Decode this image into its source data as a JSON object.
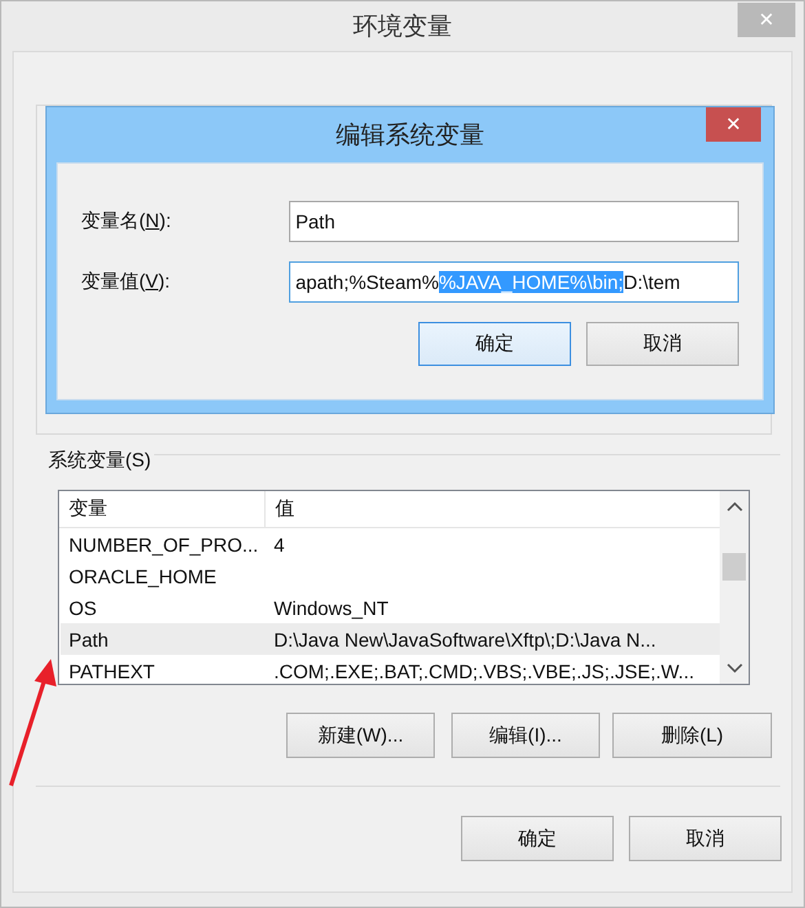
{
  "window": {
    "title": "环境变量",
    "close": "✕"
  },
  "dialog": {
    "title": "编辑系统变量",
    "close": "✕",
    "name_label": "变量名(**N**):",
    "name_value": "Path",
    "value_label": "变量值(**V**):",
    "value_before": "apath;%Steam%",
    "value_selected": "%JAVA_HOME%\\bin;",
    "value_after": "D:\\tem",
    "buttons": [
      {
        "label": "确定",
        "focused": true
      },
      {
        "label": "取消",
        "focused": false
      }
    ]
  },
  "system_vars": {
    "label": "系统变量(S)",
    "columns": [
      "变量",
      "值"
    ],
    "rows": [
      {
        "name": "NUMBER_OF_PRO...",
        "value": "4",
        "selected": false
      },
      {
        "name": "ORACLE_HOME",
        "value": "",
        "selected": false
      },
      {
        "name": "OS",
        "value": "Windows_NT",
        "selected": false
      },
      {
        "name": "Path",
        "value": "D:\\Java New\\JavaSoftware\\Xftp\\;D:\\Java N...",
        "selected": true
      },
      {
        "name": "PATHEXT",
        "value": ".COM;.EXE;.BAT;.CMD;.VBS;.VBE;.JS;.JSE;.W...",
        "selected": false
      }
    ],
    "buttons": [
      "新建(W)...",
      "编辑(I)...",
      "删除(L)"
    ]
  },
  "buttons": [
    "确定",
    "取消"
  ]
}
